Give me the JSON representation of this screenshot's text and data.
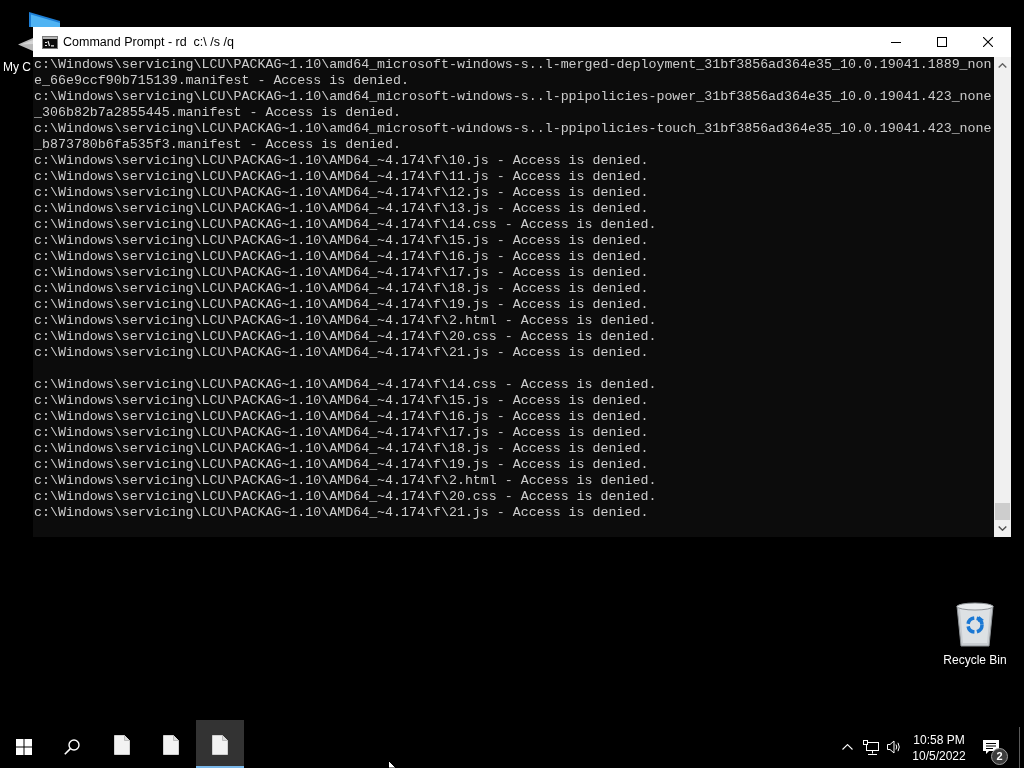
{
  "desktop": {
    "icons": [
      {
        "kind": "computer",
        "label": "My C"
      },
      {
        "kind": "recycle_bin",
        "label": "Recycle Bin"
      }
    ]
  },
  "window": {
    "title": "Command Prompt - rd  c:\\ /s /q",
    "console": {
      "blocks": [
        {
          "lines": [
            "c:\\Windows\\servicing\\LCU\\PACKAG~1.10\\amd64_microsoft-windows-s..l-merged-deployment_31bf3856ad364e35_10.0.19041.1889_non",
            "e_66e9ccf90b715139.manifest - Access is denied.",
            "c:\\Windows\\servicing\\LCU\\PACKAG~1.10\\amd64_microsoft-windows-s..l-ppipolicies-power_31bf3856ad364e35_10.0.19041.423_none",
            "_306b82b7a2855445.manifest - Access is denied.",
            "c:\\Windows\\servicing\\LCU\\PACKAG~1.10\\amd64_microsoft-windows-s..l-ppipolicies-touch_31bf3856ad364e35_10.0.19041.423_none",
            "_b873780b6fa535f3.manifest - Access is denied.",
            "c:\\Windows\\servicing\\LCU\\PACKAG~1.10\\AMD64_~4.174\\f\\10.js - Access is denied.",
            "c:\\Windows\\servicing\\LCU\\PACKAG~1.10\\AMD64_~4.174\\f\\11.js - Access is denied.",
            "c:\\Windows\\servicing\\LCU\\PACKAG~1.10\\AMD64_~4.174\\f\\12.js - Access is denied.",
            "c:\\Windows\\servicing\\LCU\\PACKAG~1.10\\AMD64_~4.174\\f\\13.js - Access is denied.",
            "c:\\Windows\\servicing\\LCU\\PACKAG~1.10\\AMD64_~4.174\\f\\14.css - Access is denied.",
            "c:\\Windows\\servicing\\LCU\\PACKAG~1.10\\AMD64_~4.174\\f\\15.js - Access is denied.",
            "c:\\Windows\\servicing\\LCU\\PACKAG~1.10\\AMD64_~4.174\\f\\16.js - Access is denied.",
            "c:\\Windows\\servicing\\LCU\\PACKAG~1.10\\AMD64_~4.174\\f\\17.js - Access is denied.",
            "c:\\Windows\\servicing\\LCU\\PACKAG~1.10\\AMD64_~4.174\\f\\18.js - Access is denied.",
            "c:\\Windows\\servicing\\LCU\\PACKAG~1.10\\AMD64_~4.174\\f\\19.js - Access is denied.",
            "c:\\Windows\\servicing\\LCU\\PACKAG~1.10\\AMD64_~4.174\\f\\2.html - Access is denied.",
            "c:\\Windows\\servicing\\LCU\\PACKAG~1.10\\AMD64_~4.174\\f\\20.css - Access is denied.",
            "c:\\Windows\\servicing\\LCU\\PACKAG~1.10\\AMD64_~4.174\\f\\21.js - Access is denied."
          ]
        },
        {
          "lines": [
            "c:\\Windows\\servicing\\LCU\\PACKAG~1.10\\AMD64_~4.174\\f\\14.css - Access is denied.",
            "c:\\Windows\\servicing\\LCU\\PACKAG~1.10\\AMD64_~4.174\\f\\15.js - Access is denied.",
            "c:\\Windows\\servicing\\LCU\\PACKAG~1.10\\AMD64_~4.174\\f\\16.js - Access is denied.",
            "c:\\Windows\\servicing\\LCU\\PACKAG~1.10\\AMD64_~4.174\\f\\17.js - Access is denied.",
            "c:\\Windows\\servicing\\LCU\\PACKAG~1.10\\AMD64_~4.174\\f\\18.js - Access is denied.",
            "c:\\Windows\\servicing\\LCU\\PACKAG~1.10\\AMD64_~4.174\\f\\19.js - Access is denied.",
            "c:\\Windows\\servicing\\LCU\\PACKAG~1.10\\AMD64_~4.174\\f\\2.html - Access is denied.",
            "c:\\Windows\\servicing\\LCU\\PACKAG~1.10\\AMD64_~4.174\\f\\20.css - Access is denied.",
            "c:\\Windows\\servicing\\LCU\\PACKAG~1.10\\AMD64_~4.174\\f\\21.js - Access is denied."
          ]
        }
      ]
    }
  },
  "taskbar": {
    "apps": [
      {
        "selected": false
      },
      {
        "selected": false
      },
      {
        "selected": true
      }
    ],
    "clock": {
      "time": "10:58 PM",
      "date": "10/5/2022"
    },
    "notifications": {
      "count": "2"
    }
  }
}
